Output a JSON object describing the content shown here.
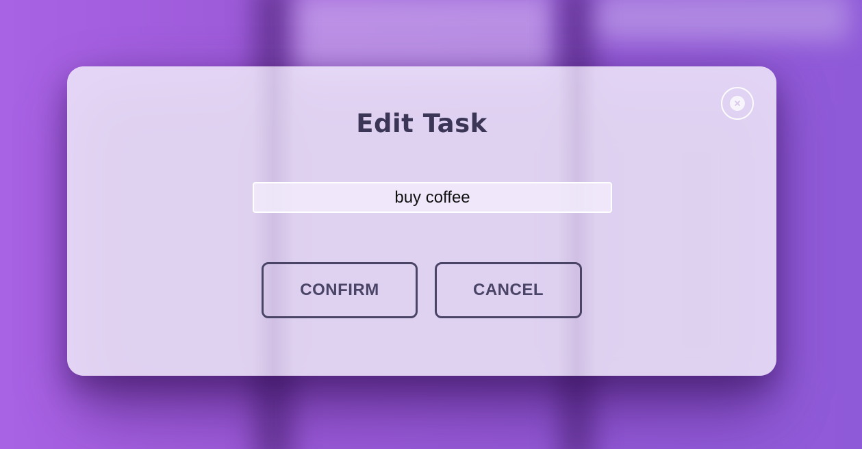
{
  "modal": {
    "title": "Edit Task",
    "close_icon": "close-icon",
    "input_value": "buy coffee",
    "confirm_label": "CONFIRM",
    "cancel_label": "CANCEL"
  },
  "colors": {
    "background": "#9c5ad8",
    "modal_surface": "#e6d8f6",
    "text_dark": "#3b3556",
    "button_border": "#4a4566"
  }
}
